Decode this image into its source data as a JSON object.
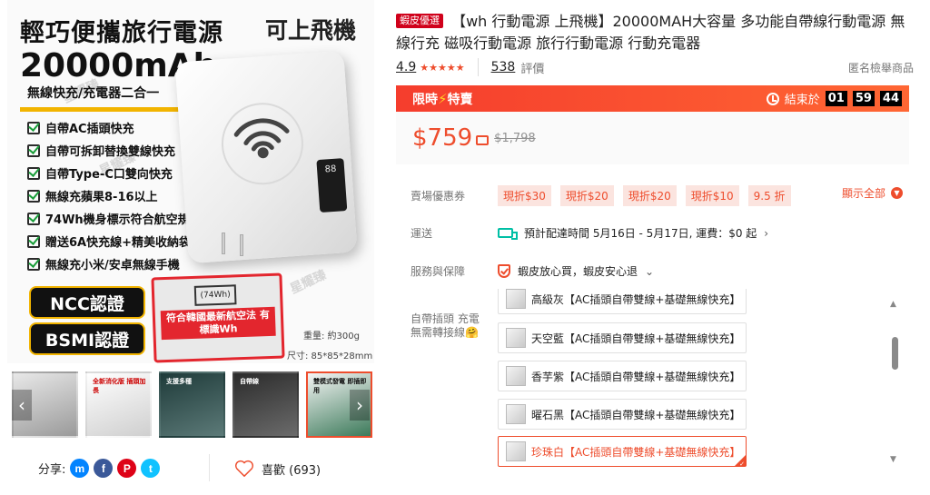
{
  "gallery": {
    "main_image": {
      "headline": "輕巧便攜旅行電源",
      "badge": "可上飛機",
      "capacity": "20000mAh",
      "subtitle": "無線快充/充電器二合一",
      "features": [
        "自帶AC插頭快充",
        "自帶可拆卸替換雙線快充",
        "自帶Type-C口雙向快充",
        "無線充蘋果8-16以上",
        "74Wh機身標示符合航空規定",
        "贈送6A快充線+精美收納袋",
        "無線充小米/安卓無線手機"
      ],
      "cert_ncc": "NCC認證",
      "cert_bsmi": "BSMI認證",
      "notice_text": "符合韓國最新航空法 有標識Wh",
      "notice_wh": "(74Wh)",
      "weight": "重量: 約300g",
      "size": "尺寸: 85*85*28mm",
      "watermark": "星耀臻"
    },
    "thumbnails": [
      {
        "label": "",
        "active": false
      },
      {
        "label": "全新消化版 插頭加長",
        "active": false
      },
      {
        "label": "支援多種",
        "active": false
      },
      {
        "label": "自帶線",
        "active": false
      },
      {
        "label": "雙模式發電 即插即用",
        "active": true
      }
    ],
    "prev_icon": "chevron-left-icon",
    "next_icon": "chevron-right-icon"
  },
  "share": {
    "label": "分享:",
    "icons": [
      "messenger-icon",
      "facebook-icon",
      "pinterest-icon",
      "twitter-icon"
    ],
    "icon_glyphs": [
      "m",
      "f",
      "P",
      "t"
    ],
    "colors": [
      "#0384ff",
      "#3b5999",
      "#de0217",
      "#10c2ff"
    ]
  },
  "favorite": {
    "label": "喜歡 (693)"
  },
  "product": {
    "tag": "蝦皮優選",
    "title": "【wh 行動電源 上飛機】20000MAH大容量 多功能自帶線行動電源 無線行充 磁吸行動電源 旅行行動電源 行動充電器",
    "rating": "4.9",
    "stars": "★★★★★",
    "review_count": "538",
    "review_label": "評價",
    "report": "匿名檢舉商品"
  },
  "flash_sale": {
    "label": "限時",
    "label2": "特賣",
    "ends_label": "結束於",
    "hours": "01",
    "minutes": "59",
    "seconds": "44"
  },
  "price": {
    "current": "$759",
    "original": "$1,798"
  },
  "vouchers": {
    "label": "賣場優惠券",
    "items": [
      "現折$30",
      "現折$20",
      "現折$20",
      "現折$10",
      "9.5 折"
    ],
    "show_all": "顯示全部"
  },
  "shipping": {
    "label": "運送",
    "text": "預計配達時間 5月16日 - 5月17日, 運費：$0 起"
  },
  "guarantee": {
    "label": "服務與保障",
    "text": "蝦皮放心買，蝦皮安心退"
  },
  "variations": {
    "label": "自帶插頭 充電無需轉接線🤗",
    "options": [
      {
        "name": "高級灰【AC插頭自帶雙線+基礎無線快充】",
        "selected": false
      },
      {
        "name": "天空藍【AC插頭自帶雙線+基礎無線快充】",
        "selected": false
      },
      {
        "name": "香芋紫【AC插頭自帶雙線+基礎無線快充】",
        "selected": false
      },
      {
        "name": "曜石黑【AC插頭自帶雙線+基礎無線快充】",
        "selected": false
      },
      {
        "name": "珍珠白【AC插頭自帶雙線+基礎無線快充】",
        "selected": true
      }
    ]
  },
  "colors": {
    "accent": "#ee4d2d",
    "flash_bg": "#f53d2d",
    "badge_red": "#d0011b"
  }
}
